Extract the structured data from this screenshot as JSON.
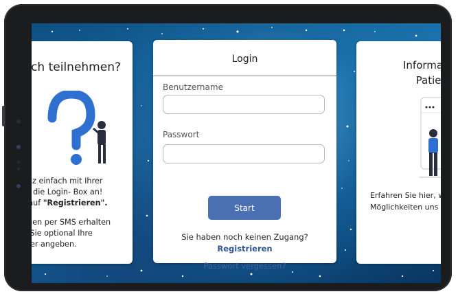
{
  "left_card": {
    "title": "ch teilnehmen?",
    "line1": "ganz einfach mit Ihrer",
    "line2": "ber die Login- Box an!",
    "line3_prefix": "ür auf ",
    "line3_bold": "\"Registrieren\".",
    "line4": "ungen per SMS erhalten",
    "line5": "en Sie optional Ihre",
    "line6": "nmer angeben."
  },
  "login": {
    "title": "Login",
    "username_label": "Benutzername",
    "username_value": "",
    "password_label": "Passwort",
    "password_value": "",
    "start_label": "Start",
    "no_access_text": "Sie haben noch keinen Zugang?",
    "register_label": "Registrieren",
    "forgot_label": "Passwort vergessen?"
  },
  "right_card": {
    "title_line1": "Informa",
    "title_line2": "Patie",
    "text_line1": "Erfahren Sie hier, w",
    "text_line2": "Möglichkeiten uns"
  },
  "colors": {
    "accent": "#4a6fb2",
    "link": "#2f5597",
    "illustration_blue": "#2f6fd0",
    "illustration_dark": "#2a2d3e"
  }
}
